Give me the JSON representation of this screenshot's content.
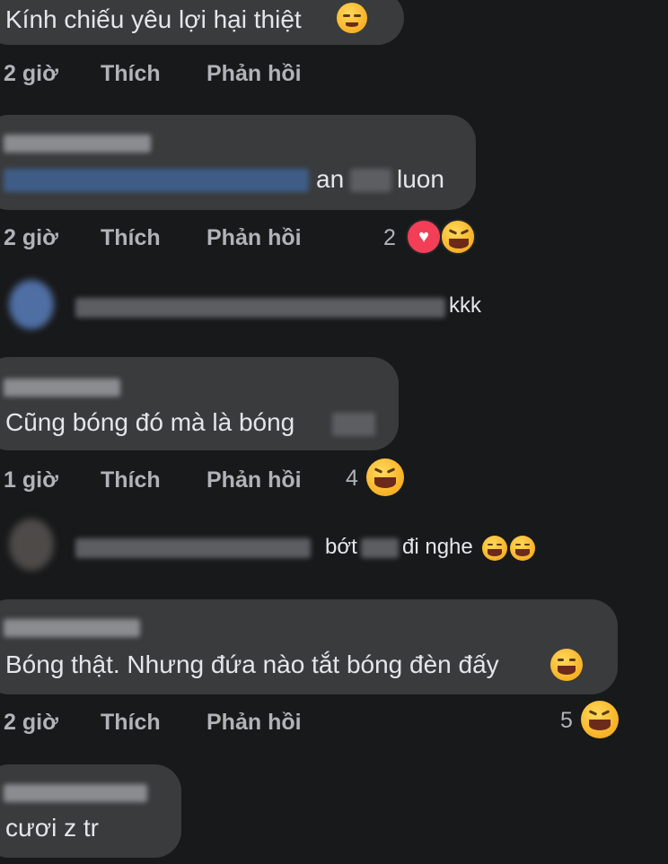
{
  "comments": [
    {
      "text": "Kính chiếu yêu lợi hại thiệt",
      "time": "2 giờ",
      "like": "Thích",
      "reply": "Phản hồi"
    },
    {
      "text_a": "an",
      "text_b": "luon",
      "time": "2 giờ",
      "like": "Thích",
      "reply": "Phản hồi",
      "reaction_count": "2"
    },
    {
      "text": "kkk"
    },
    {
      "text": "Cũng bóng đó mà là bóng",
      "time": "1 giờ",
      "like": "Thích",
      "reply": "Phản hồi",
      "reaction_count": "4"
    },
    {
      "text_a": "bớt",
      "text_b": "đi nghe"
    },
    {
      "text": "Bóng thật. Nhưng đứa nào tắt bóng đèn đấy",
      "time": "2 giờ",
      "like": "Thích",
      "reply": "Phản hồi",
      "reaction_count": "5"
    },
    {
      "text": "cươi z tr"
    }
  ],
  "icons": {
    "relieved": "relieved-emoji-icon",
    "laugh": "laughing-emoji-icon",
    "grin": "grinning-emoji-icon",
    "heart": "heart-reaction-icon"
  },
  "colors": {
    "background": "#18191a",
    "bubble": "#3a3b3c",
    "meta": "#b0b3b8",
    "heart": "#f33e58",
    "emoji": "#f7b125"
  }
}
